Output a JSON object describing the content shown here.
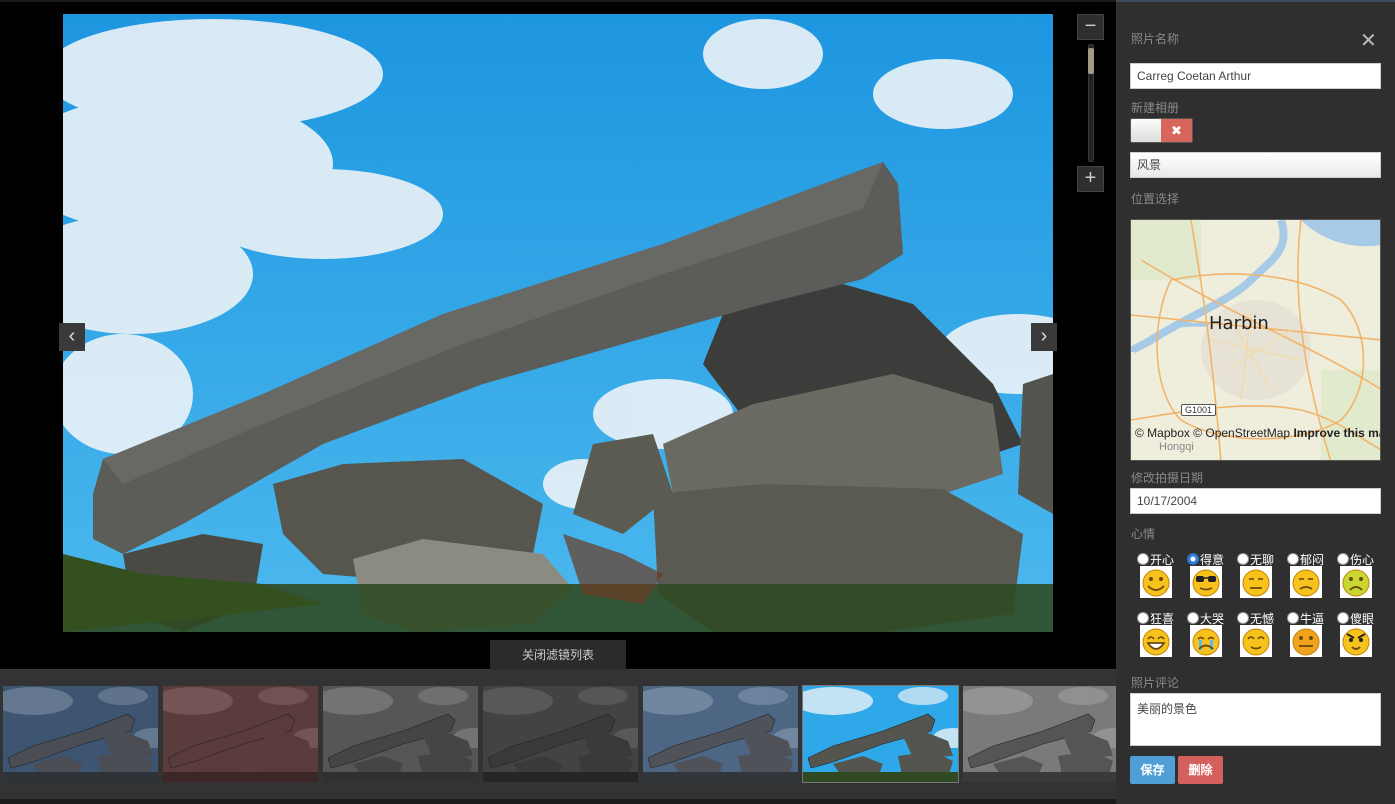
{
  "viewer": {
    "prev_icon": "‹",
    "next_icon": "›",
    "zoom_out_icon": "−",
    "zoom_in_icon": "+",
    "filter_toggle_label": "关闭滤镜列表"
  },
  "filters": {
    "thumbs": [
      {
        "name": "filter-blue-dark"
      },
      {
        "name": "filter-red-dark"
      },
      {
        "name": "filter-grayscale"
      },
      {
        "name": "filter-grayscale-dark"
      },
      {
        "name": "filter-blue-muted"
      },
      {
        "name": "filter-original",
        "active": true
      },
      {
        "name": "filter-grayscale-light"
      }
    ]
  },
  "sidebar": {
    "close_icon": "✕",
    "photo_name_label": "照片名称",
    "photo_name_value": "Carreg Coetan Arthur",
    "new_album_label": "新建相册",
    "toggle_off_icon": "✖",
    "album_value": "风景",
    "location_label": "位置选择",
    "map": {
      "city": "Harbin",
      "sublabel": "Hongqi",
      "road_shield": "G1001",
      "attribution": "© Mapbox © OpenStreetMap",
      "improve": "Improve this map"
    },
    "date_label": "修改拍摄日期",
    "date_value": "10/17/2004",
    "mood_label": "心情",
    "moods": [
      {
        "label": "开心",
        "icon": "happy-emoticon-icon"
      },
      {
        "label": "得意",
        "icon": "cool-sunglasses-emoticon-icon",
        "checked": true
      },
      {
        "label": "无聊",
        "icon": "bored-emoticon-icon"
      },
      {
        "label": "郁闷",
        "icon": "gloomy-emoticon-icon"
      },
      {
        "label": "伤心",
        "icon": "sad-emoticon-icon"
      },
      {
        "label": "狂喜",
        "icon": "ecstatic-emoticon-icon"
      },
      {
        "label": "大哭",
        "icon": "crying-emoticon-icon"
      },
      {
        "label": "无憾",
        "icon": "content-emoticon-icon"
      },
      {
        "label": "牛逼",
        "icon": "awesome-emoticon-icon"
      },
      {
        "label": "傻眼",
        "icon": "stunned-emoticon-icon"
      }
    ],
    "comment_label": "照片评论",
    "comment_value": "美丽的景色",
    "save_label": "保存",
    "delete_label": "删除"
  },
  "colors": {
    "sky": "#2ea8e8",
    "rock": "#5a5a55",
    "grass": "#3c5a2a",
    "save": "#4f9fd6",
    "delete": "#d4605d"
  }
}
